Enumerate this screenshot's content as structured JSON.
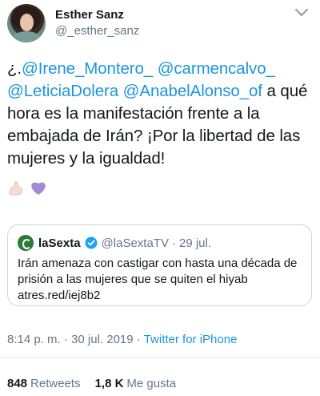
{
  "user": {
    "name": "Esther Sanz",
    "handle": "@_esther_sanz"
  },
  "tweet": {
    "text_prefix": "¿.",
    "mentions": [
      "@Irene_Montero_",
      "@carmencalvo_",
      "@LeticiaDolera",
      "@AnabelAlonso_of"
    ],
    "text_body": " a qué hora es la manifestación frente a la embajada de Irán? ¡Por la libertad de las mujeres y la igualdad!",
    "emojis": [
      "flexed-biceps-icon",
      "purple-heart-icon"
    ]
  },
  "quoted_tweet": {
    "name": "laSexta",
    "handle": "@laSextaTV",
    "separator": "·",
    "date": "29 jul.",
    "text": "Irán amenaza con castigar con hasta una década de prisión a las mujeres que se quiten el hiyab atres.red/iej8b2"
  },
  "meta": {
    "time": "8:14 p. m.",
    "date": "30 jul. 2019",
    "separator": "·",
    "source": "Twitter for iPhone"
  },
  "stats": {
    "retweets_count": "848",
    "retweets_label": "Retweets",
    "likes_count": "1,8 K",
    "likes_label": "Me gusta"
  },
  "colors": {
    "link": "#1b95e0",
    "secondary": "#657786",
    "border": "#ccd6dd",
    "laSexta": "#2b7a39"
  }
}
